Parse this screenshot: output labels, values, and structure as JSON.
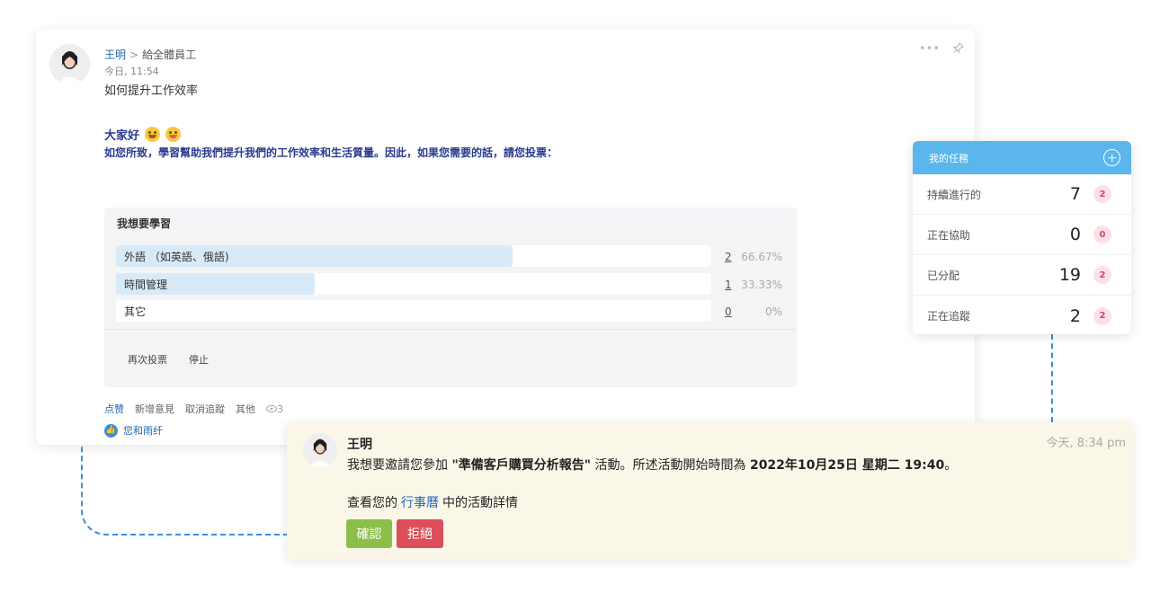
{
  "post": {
    "author": "王明",
    "separator": ">",
    "recipient": "給全體員工",
    "timestamp": "今日, 11:54",
    "title": "如何提升工作效率",
    "greeting": "大家好",
    "message": "如您所致，學習幫助我們提升我們的工作效率和生活質量。因此，如果您需要的話，請您投票：",
    "icons": [
      "more-icon",
      "pin-icon"
    ],
    "poll": {
      "question": "我想要學習",
      "options": [
        {
          "label": "外語 （如英語、俄語)",
          "count": "2",
          "percent": "66.67%",
          "fraction": 0.6667
        },
        {
          "label": "時間管理",
          "count": "1",
          "percent": "33.33%",
          "fraction": 0.3333
        },
        {
          "label": "其它",
          "count": "0",
          "percent": "0%",
          "fraction": 0
        }
      ],
      "vote_again": "再次投票",
      "stop": "停止"
    },
    "footer": {
      "like": "点赞",
      "add_comment": "新增意見",
      "unfollow": "取消追蹤",
      "more": "其他",
      "views": "3"
    },
    "liked_by": "您和雨纤"
  },
  "tasks": {
    "title": "我的任務",
    "rows": [
      {
        "label": "持續進行的",
        "count": "7",
        "badge": "2"
      },
      {
        "label": "正在協助",
        "count": "0",
        "badge": "0"
      },
      {
        "label": "已分配",
        "count": "19",
        "badge": "2"
      },
      {
        "label": "正在追蹤",
        "count": "2",
        "badge": "2"
      }
    ]
  },
  "invite": {
    "name": "王明",
    "time": "今天, 8:34 pm",
    "text_before": "我想要邀請您參加",
    "event_name": "\"準備客戶購買分析報告\"",
    "text_middle": "活動。所述活動開始時間為",
    "datetime": "2022年10月25日 星期二 19:40",
    "text_end": "。",
    "calendar_before": "查看您的",
    "calendar_link": "行事曆",
    "calendar_after": "中的活動詳情",
    "confirm": "確認",
    "decline": "拒絕"
  },
  "colors": {
    "link": "#2067b0",
    "tasks_header": "#5ab6ec",
    "confirm": "#8bbf4a",
    "decline": "#db4e5a",
    "invite_bg": "#fbf7e8"
  }
}
